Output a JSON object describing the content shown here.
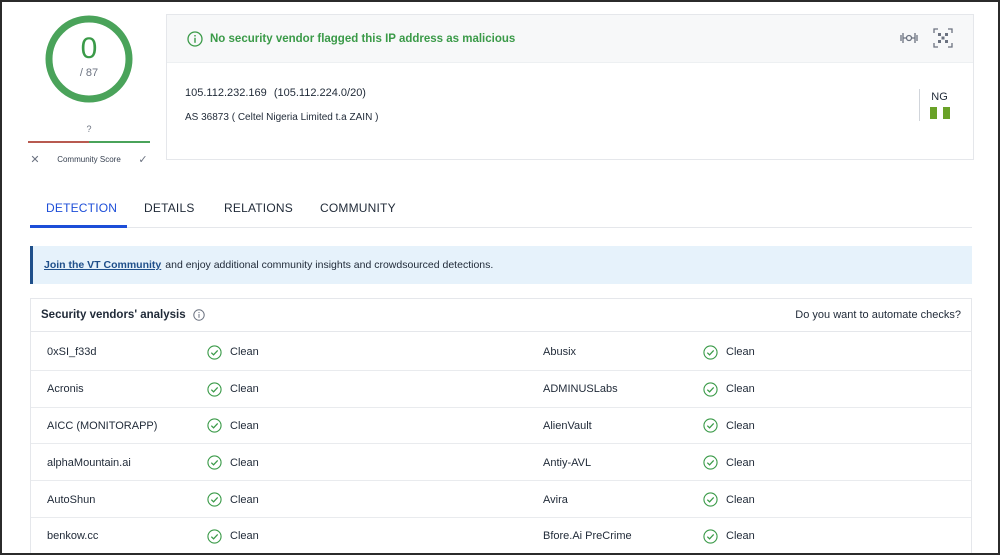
{
  "score": {
    "detections": "0",
    "total": "/ 87",
    "color": "#3a9a48"
  },
  "community_score": {
    "value": "?",
    "label": "Community Score",
    "down_glyph": "✕",
    "up_glyph": "✓"
  },
  "banner": {
    "message": "No security vendor flagged this IP address as malicious",
    "icons": [
      "network-graph-icon",
      "qr-scan-icon"
    ]
  },
  "ip": {
    "address": "105.112.232.169",
    "range": "(105.112.224.0/20)",
    "as": "AS 36873 ( Celtel Nigeria Limited t.a ZAIN )"
  },
  "country": {
    "code": "NG",
    "flag_color": "#6aa228"
  },
  "tabs": [
    {
      "label": "DETECTION"
    },
    {
      "label": "DETAILS"
    },
    {
      "label": "RELATIONS"
    },
    {
      "label": "COMMUNITY"
    }
  ],
  "community_banner": {
    "link": "Join the VT Community",
    "text": "and enjoy additional community insights and crowdsourced detections."
  },
  "vendors": {
    "title": "Security vendors' analysis",
    "automate": "Do you want to automate checks?",
    "rows": [
      [
        {
          "name": "0xSI_f33d",
          "result": "Clean"
        },
        {
          "name": "Abusix",
          "result": "Clean"
        }
      ],
      [
        {
          "name": "Acronis",
          "result": "Clean"
        },
        {
          "name": "ADMINUSLabs",
          "result": "Clean"
        }
      ],
      [
        {
          "name": "AICC (MONITORAPP)",
          "result": "Clean"
        },
        {
          "name": "AlienVault",
          "result": "Clean"
        }
      ],
      [
        {
          "name": "alphaMountain.ai",
          "result": "Clean"
        },
        {
          "name": "Antiy-AVL",
          "result": "Clean"
        }
      ],
      [
        {
          "name": "AutoShun",
          "result": "Clean"
        },
        {
          "name": "Avira",
          "result": "Clean"
        }
      ],
      [
        {
          "name": "benkow.cc",
          "result": "Clean"
        },
        {
          "name": "Bfore.Ai PreCrime",
          "result": "Clean"
        }
      ]
    ]
  }
}
